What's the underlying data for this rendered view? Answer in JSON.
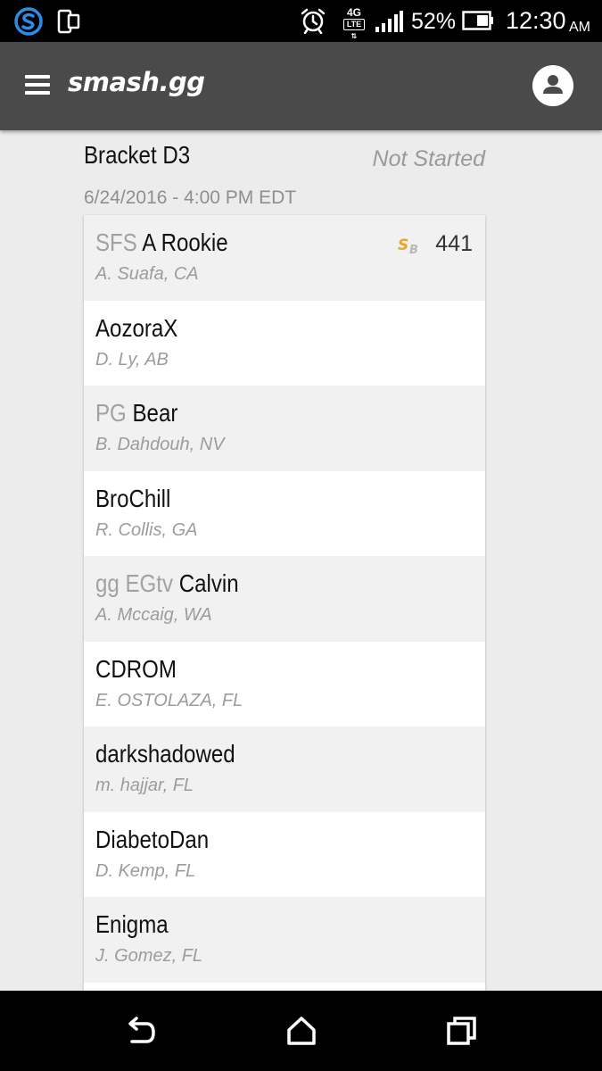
{
  "status_bar": {
    "battery_percent": "52%",
    "time": "12:30",
    "ampm": "AM",
    "network": "4G LTE",
    "icons": [
      "app-s-icon",
      "phone-sync-icon",
      "alarm-icon",
      "lte-icon",
      "signal-icon",
      "battery-icon"
    ]
  },
  "app_bar": {
    "logo": "smash.gg",
    "menu_icon": "hamburger-menu-icon",
    "avatar_icon": "user-avatar-icon"
  },
  "bracket": {
    "title": "Bracket D3",
    "status": "Not Started",
    "date": "6/24/2016 - 4:00 PM EDT"
  },
  "entrants": [
    {
      "prefix": "SFS",
      "name": "A Rookie",
      "sub": "A. Suafa, CA",
      "score": "441",
      "badge": "SB"
    },
    {
      "prefix": "",
      "name": "AozoraX",
      "sub": "D. Ly, AB"
    },
    {
      "prefix": "PG",
      "name": "Bear",
      "sub": "B. Dahdouh, NV"
    },
    {
      "prefix": "",
      "name": "BroChill",
      "sub": "R. Collis, GA"
    },
    {
      "prefix": "gg EGtv",
      "name": "Calvin",
      "sub": "A. Mccaig, WA"
    },
    {
      "prefix": "",
      "name": "CDROM",
      "sub": "E. OSTOLAZA, FL"
    },
    {
      "prefix": "",
      "name": "darkshadowed",
      "sub": "m. hajjar, FL"
    },
    {
      "prefix": "",
      "name": "DiabetoDan",
      "sub": "D. Kemp, FL"
    },
    {
      "prefix": "",
      "name": "Enigma",
      "sub": "J. Gomez, FL"
    }
  ],
  "nav_bar": {
    "icons": [
      "back-icon",
      "home-icon",
      "recents-icon"
    ]
  }
}
